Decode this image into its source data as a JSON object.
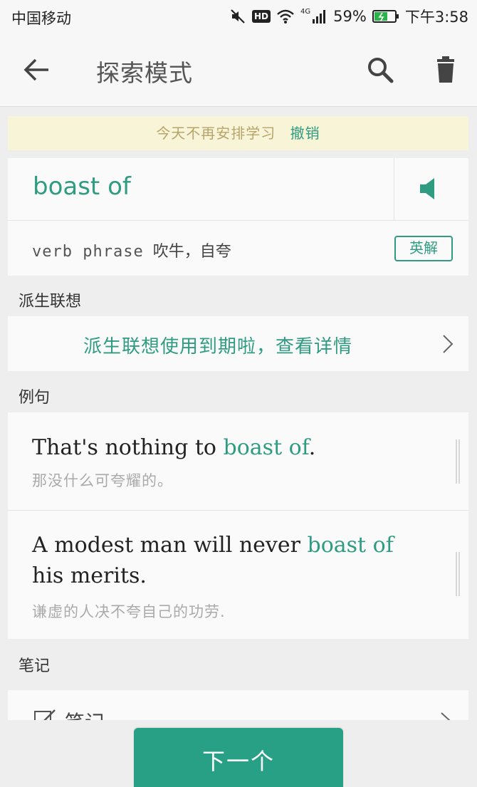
{
  "status_bar": {
    "carrier": "中国移动",
    "hd_badge": "HD",
    "network": "4G",
    "battery": "59%",
    "time": "下午3:58"
  },
  "app_bar": {
    "title": "探索模式",
    "icons": {
      "back": "back-arrow-icon",
      "search": "search-icon",
      "delete": "trash-icon"
    }
  },
  "banner": {
    "text": "今天不再安排学习",
    "action": "撤销"
  },
  "word": {
    "term": "boast of",
    "part_of_speech": "verb phrase",
    "meaning": "吹牛，自夸",
    "en_definition_button": "英解",
    "speaker_icon": "speaker-icon"
  },
  "sections": {
    "derivatives_label": "派生联想",
    "derivatives_link": "派生联想使用到期啦，查看详情",
    "examples_label": "例句",
    "notes_label": "笔记"
  },
  "examples": [
    {
      "prefix": "That's nothing to ",
      "highlight": "boast of",
      "suffix": ".",
      "translation": "那没什么可夸耀的。"
    },
    {
      "prefix": "A modest man will never ",
      "highlight": "boast of",
      "suffix": " his merits.",
      "translation": "谦虚的人决不夸自己的功劳."
    }
  ],
  "notes": {
    "label": "笔记",
    "icon": "edit-note-icon"
  },
  "next_button": "下一个",
  "colors": {
    "accent": "#2f9c82",
    "button": "#27a085",
    "banner_bg": "#f8f4d8",
    "banner_text": "#b8a46a"
  }
}
